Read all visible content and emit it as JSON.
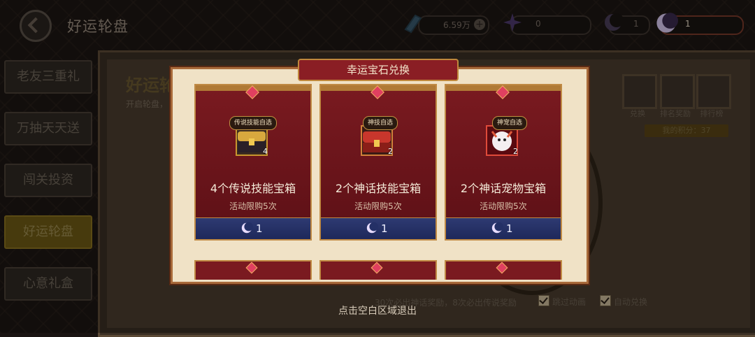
{
  "header": {
    "title": "好运轮盘",
    "resources": [
      {
        "name": "crystal",
        "value": "6.59万"
      },
      {
        "name": "star",
        "value": "0"
      },
      {
        "name": "moon",
        "value": "1"
      },
      {
        "name": "lucky-moon",
        "value": "1"
      }
    ]
  },
  "sidebar": {
    "items": [
      {
        "label": "老友三重礼"
      },
      {
        "label": "万抽天天送"
      },
      {
        "label": "闯关投资"
      },
      {
        "label": "好运轮盘"
      },
      {
        "label": "心意礼盒"
      }
    ],
    "active_index": 3
  },
  "panel": {
    "title": "好运轮",
    "subtitle": "开启轮盘，",
    "buttons": [
      {
        "label": "兑换"
      },
      {
        "label": "排名奖励"
      },
      {
        "label": "排行榜"
      }
    ],
    "score": "我的积分：37",
    "bottom_tip": "30次必出神话奖励，8次必出传说奖励",
    "checkboxes": [
      {
        "label": "跳过动画",
        "checked": true
      },
      {
        "label": "自动兑换",
        "checked": true
      }
    ]
  },
  "modal": {
    "title": "幸运宝石兑换",
    "cards": [
      {
        "tag": "传说技能自选",
        "qty": "4",
        "name": "4个传说技能宝箱",
        "limit": "活动限购5次",
        "price": "1",
        "icon": "chest-gold-icon"
      },
      {
        "tag": "神技自选",
        "qty": "2",
        "name": "2个神话技能宝箱",
        "limit": "活动限购5次",
        "price": "1",
        "icon": "chest-red-icon"
      },
      {
        "tag": "神宠自选",
        "qty": "2",
        "name": "2个神话宠物宝箱",
        "limit": "活动限购5次",
        "price": "1",
        "icon": "pet-egg-icon"
      }
    ]
  },
  "exit_tip": "点击空白区域退出",
  "colors": {
    "accent": "#8a1e24",
    "gold": "#c08a44",
    "buy_bar": "#1e285a"
  }
}
